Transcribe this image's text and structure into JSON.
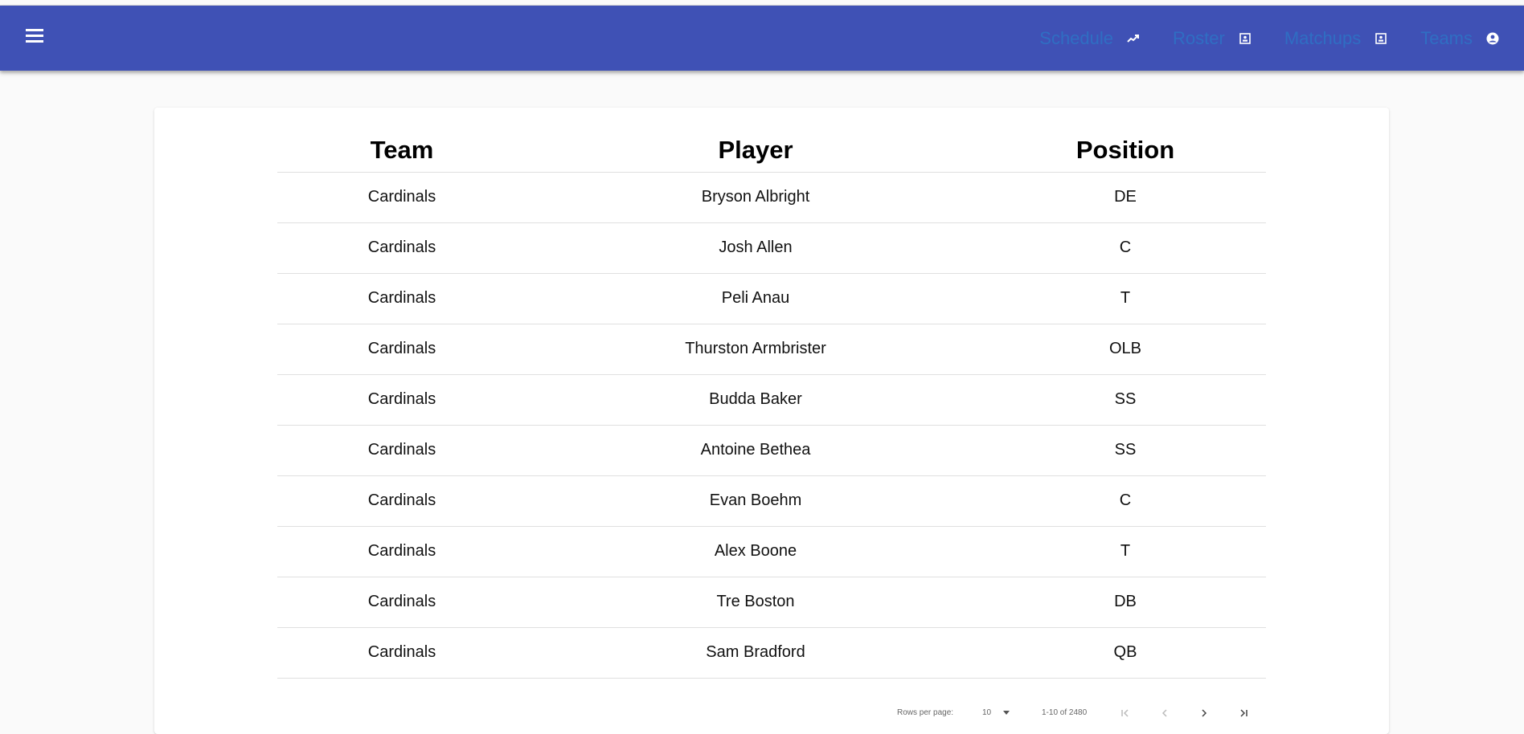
{
  "nav": {
    "items": [
      {
        "label": "Schedule",
        "icon": "trending-up-icon"
      },
      {
        "label": "Roster",
        "icon": "contact-card-icon"
      },
      {
        "label": "Matchups",
        "icon": "contact-card-icon"
      },
      {
        "label": "Teams",
        "icon": "account-circle-icon"
      }
    ]
  },
  "table": {
    "headers": [
      "Team",
      "Player",
      "Position"
    ],
    "rows": [
      [
        "Cardinals",
        "Bryson Albright",
        "DE"
      ],
      [
        "Cardinals",
        "Josh Allen",
        "C"
      ],
      [
        "Cardinals",
        "Peli Anau",
        "T"
      ],
      [
        "Cardinals",
        "Thurston Armbrister",
        "OLB"
      ],
      [
        "Cardinals",
        "Budda Baker",
        "SS"
      ],
      [
        "Cardinals",
        "Antoine Bethea",
        "SS"
      ],
      [
        "Cardinals",
        "Evan Boehm",
        "C"
      ],
      [
        "Cardinals",
        "Alex Boone",
        "T"
      ],
      [
        "Cardinals",
        "Tre Boston",
        "DB"
      ],
      [
        "Cardinals",
        "Sam Bradford",
        "QB"
      ]
    ]
  },
  "pagination": {
    "rows_per_page_label": "Rows per page:",
    "rows_per_page_value": "10",
    "range_text": "1-10 of 2480"
  },
  "colors": {
    "appbar": "#3f51b5",
    "nav_text": "#2a78c8"
  }
}
